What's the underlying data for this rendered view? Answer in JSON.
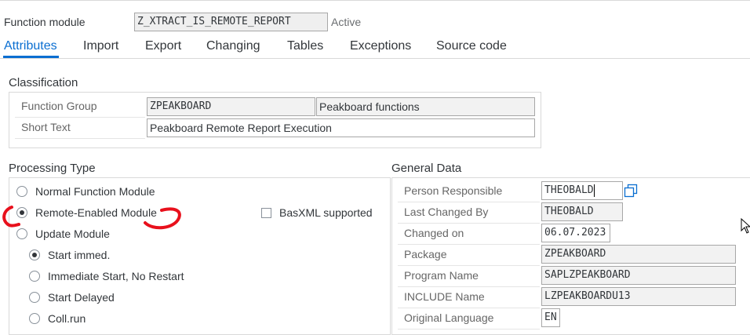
{
  "header": {
    "function_module_label": "Function module",
    "function_module_value": "Z_XTRACT_IS_REMOTE_REPORT",
    "status": "Active"
  },
  "tabs": [
    {
      "label": "Attributes",
      "active": true
    },
    {
      "label": "Import"
    },
    {
      "label": "Export"
    },
    {
      "label": "Changing"
    },
    {
      "label": "Tables"
    },
    {
      "label": "Exceptions"
    },
    {
      "label": "Source code"
    }
  ],
  "classification": {
    "title": "Classification",
    "function_group_label": "Function Group",
    "function_group_value": "ZPEAKBOARD",
    "function_group_desc": "Peakboard functions",
    "short_text_label": "Short Text",
    "short_text_value": "Peakboard Remote Report Execution"
  },
  "processing_type": {
    "title": "Processing Type",
    "options": [
      {
        "label": "Normal Function Module",
        "checked": false
      },
      {
        "label": "Remote-Enabled Module",
        "checked": true
      },
      {
        "label": "Update Module",
        "checked": false
      }
    ],
    "update_options": [
      {
        "label": "Start immed.",
        "checked": true
      },
      {
        "label": "Immediate Start, No Restart",
        "checked": false
      },
      {
        "label": "Start Delayed",
        "checked": false
      },
      {
        "label": "Coll.run",
        "checked": false
      }
    ],
    "basxml_label": "BasXML supported",
    "basxml_checked": false
  },
  "general_data": {
    "title": "General Data",
    "person_responsible_label": "Person Responsible",
    "person_responsible_value": "THEOBALD",
    "last_changed_by_label": "Last Changed By",
    "last_changed_by_value": "THEOBALD",
    "changed_on_label": "Changed on",
    "changed_on_value": "06.07.2023",
    "package_label": "Package",
    "package_value": "ZPEAKBOARD",
    "program_name_label": "Program Name",
    "program_name_value": "SAPLZPEAKBOARD",
    "include_name_label": "INCLUDE Name",
    "include_name_value": "LZPEAKBOARDU13",
    "original_language_label": "Original Language",
    "original_language_value": "EN"
  },
  "colors": {
    "accent": "#0a6ed1",
    "annotation": "#e8101c"
  }
}
